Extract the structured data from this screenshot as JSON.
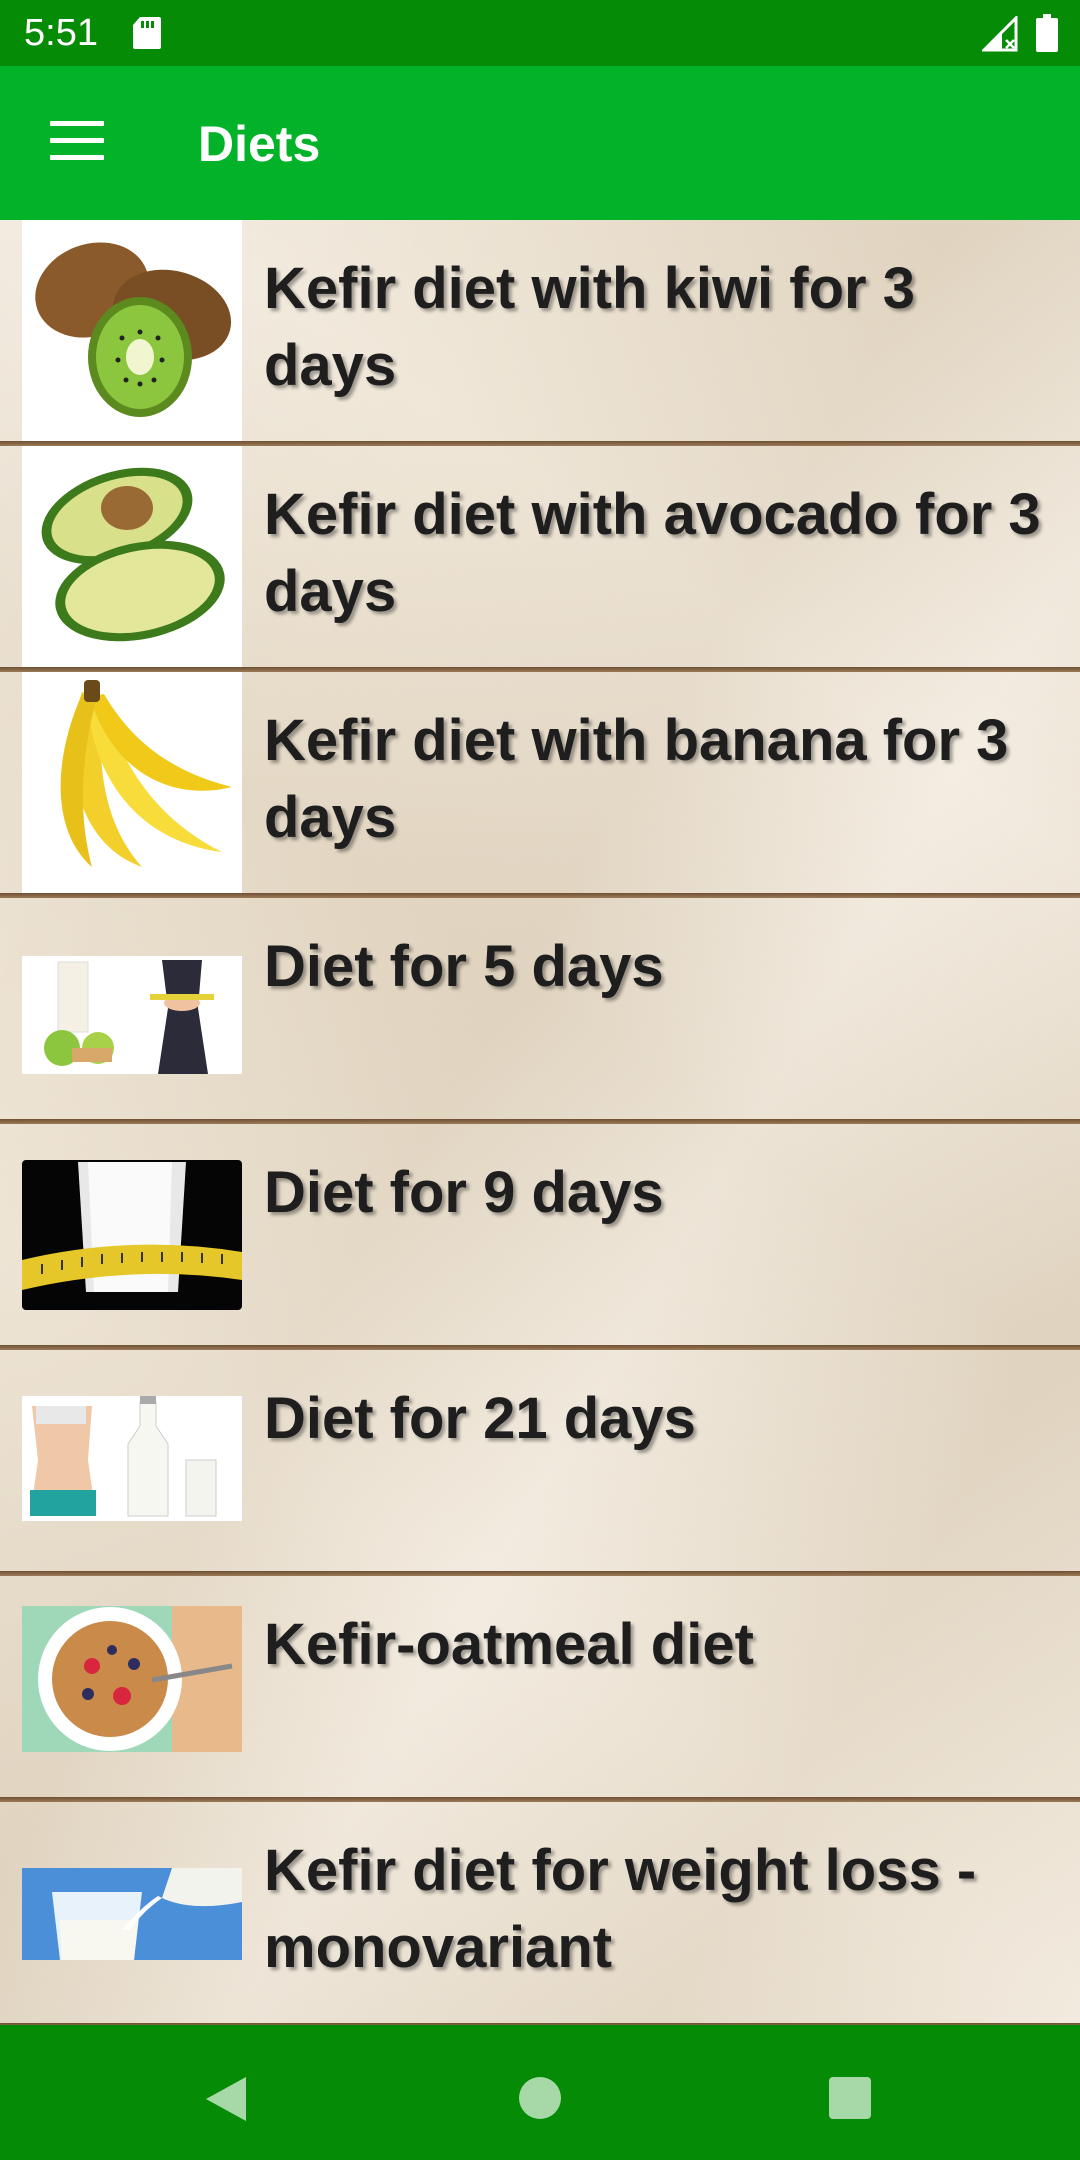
{
  "status_bar": {
    "time": "5:51",
    "icons": [
      "sd-card-icon",
      "signal-icon",
      "battery-icon"
    ]
  },
  "app_bar": {
    "title": "Diets",
    "menu_icon": "menu-icon"
  },
  "diets": [
    {
      "title": "Kefir diet with kiwi for 3 days",
      "image": "kiwi"
    },
    {
      "title": "Kefir diet with avocado for 3 days",
      "image": "avocado"
    },
    {
      "title": "Kefir diet with banana for 3 days",
      "image": "banana"
    },
    {
      "title": "Diet for 5 days",
      "image": "milk-apples-waist"
    },
    {
      "title": "Diet for 9 days",
      "image": "milk-glass-tape"
    },
    {
      "title": "Diet for 21 days",
      "image": "waist-milk-bottles"
    },
    {
      "title": "Kefir-oatmeal diet",
      "image": "oatmeal-bowl"
    },
    {
      "title": "Kefir diet for weight loss - monovariant",
      "image": "milk-pour"
    }
  ],
  "nav_bar": {
    "icons": [
      "back-icon",
      "home-icon",
      "recents-icon"
    ]
  },
  "colors": {
    "status_bar": "#058b05",
    "app_bar": "#02b32a",
    "nav_bar": "#058b05",
    "divider": "#7a5a3c"
  }
}
